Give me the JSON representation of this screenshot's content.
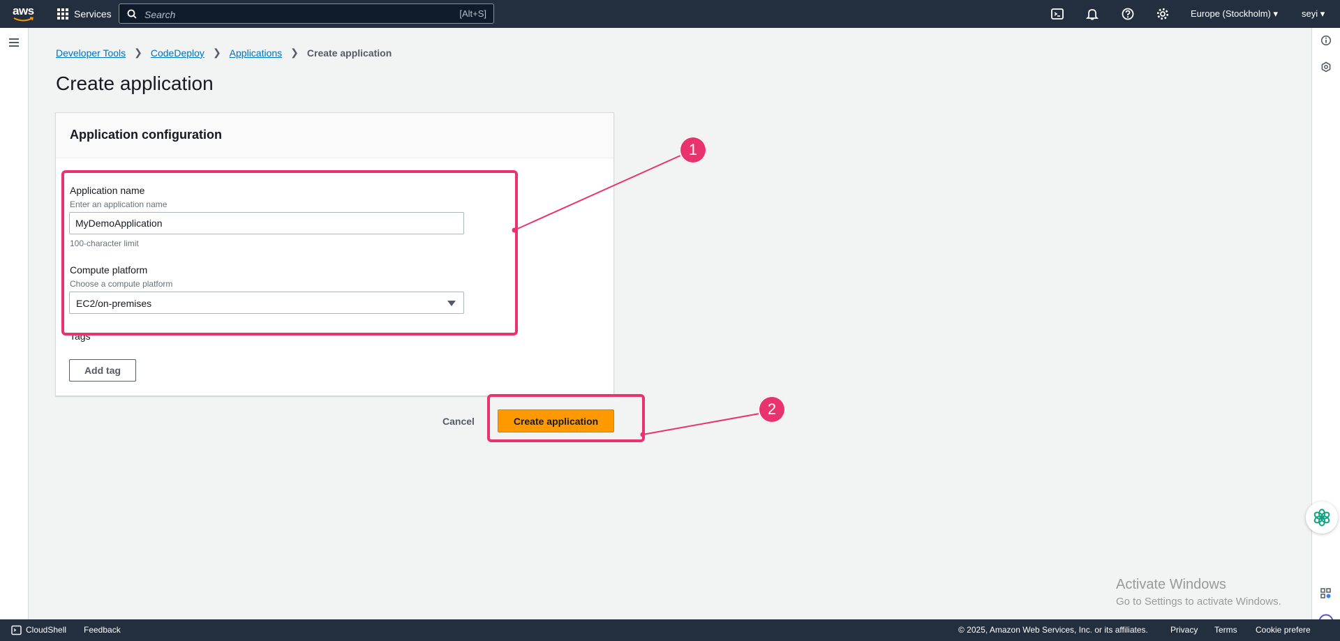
{
  "nav": {
    "logo": "aws",
    "services": "Services",
    "search_placeholder": "Search",
    "search_hint": "[Alt+S]",
    "region": "Europe (Stockholm) ▾",
    "user": "seyi ▾"
  },
  "breadcrumb": {
    "items": [
      "Developer Tools",
      "CodeDeploy",
      "Applications"
    ],
    "current": "Create application"
  },
  "page": {
    "title": "Create application"
  },
  "panel": {
    "title": "Application configuration",
    "app_name_label": "Application name",
    "app_name_desc": "Enter an application name",
    "app_name_value": "MyDemoApplication",
    "app_name_constraint": "100-character limit",
    "compute_label": "Compute platform",
    "compute_desc": "Choose a compute platform",
    "compute_value": "EC2/on-premises",
    "tags_label": "Tags",
    "add_tag": "Add tag"
  },
  "actions": {
    "cancel": "Cancel",
    "create": "Create application"
  },
  "annotations": {
    "step1": "1",
    "step2": "2",
    "color": "#e8336f"
  },
  "watermark": {
    "line1": "Activate Windows",
    "line2": "Go to Settings to activate Windows."
  },
  "footer": {
    "cloudshell": "CloudShell",
    "feedback": "Feedback",
    "copyright": "© 2025, Amazon Web Services, Inc. or its affiliates.",
    "privacy": "Privacy",
    "terms": "Terms",
    "cookie": "Cookie prefere"
  }
}
